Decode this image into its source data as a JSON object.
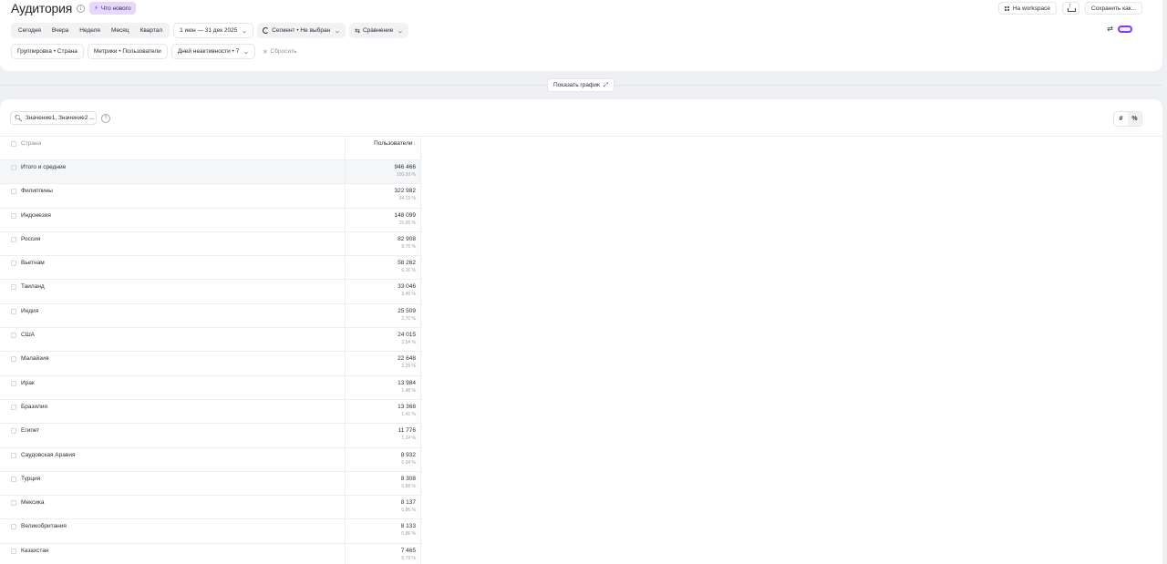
{
  "header": {
    "title": "Аудитория",
    "whats_new": "Что нового",
    "workspace_btn": "На workspace",
    "save_btn": "Сохранить как..."
  },
  "period": {
    "options": [
      "Сегодня",
      "Вчера",
      "Неделя",
      "Месяц",
      "Квартал"
    ],
    "range": "1 июн — 31 дек 2025"
  },
  "segment_label": "Сегмент • Не выбран",
  "compare_label": "Сравнение",
  "filters": {
    "grouping": "Группировка • Страна",
    "metrics": "Метрики • Пользователи",
    "inactive": "Дней неактивности • 7",
    "reset": "Сбросить"
  },
  "show_chart": "Показать график",
  "search": {
    "value": "Значение1, Значение2 ..."
  },
  "mode": {
    "abs": "#",
    "pct": "%"
  },
  "table": {
    "col_country": "Страна",
    "col_users": "Пользователи",
    "rows": [
      {
        "name": "Итого и средние",
        "value": "946 466",
        "pct": "100,00 %"
      },
      {
        "name": "Филиппины",
        "value": "322 982",
        "pct": "34,13 %"
      },
      {
        "name": "Индонезия",
        "value": "148 099",
        "pct": "15,65 %"
      },
      {
        "name": "Россия",
        "value": "82 908",
        "pct": "8,76 %"
      },
      {
        "name": "Вьетнам",
        "value": "58 262",
        "pct": "6,16 %"
      },
      {
        "name": "Таиланд",
        "value": "33 046",
        "pct": "3,49 %"
      },
      {
        "name": "Индия",
        "value": "25 509",
        "pct": "2,70 %"
      },
      {
        "name": "США",
        "value": "24 015",
        "pct": "2,54 %"
      },
      {
        "name": "Малайзия",
        "value": "22 648",
        "pct": "2,39 %"
      },
      {
        "name": "Ирак",
        "value": "13 984",
        "pct": "1,48 %"
      },
      {
        "name": "Бразилия",
        "value": "13 368",
        "pct": "1,41 %"
      },
      {
        "name": "Египет",
        "value": "11 776",
        "pct": "1,24 %"
      },
      {
        "name": "Саудовская Аравия",
        "value": "8 932",
        "pct": "0,94 %"
      },
      {
        "name": "Турция",
        "value": "8 308",
        "pct": "0,88 %"
      },
      {
        "name": "Мексика",
        "value": "8 137",
        "pct": "0,86 %"
      },
      {
        "name": "Великобритания",
        "value": "8 133",
        "pct": "0,86 %"
      },
      {
        "name": "Казахстан",
        "value": "7 465",
        "pct": "0,79 %"
      }
    ]
  }
}
